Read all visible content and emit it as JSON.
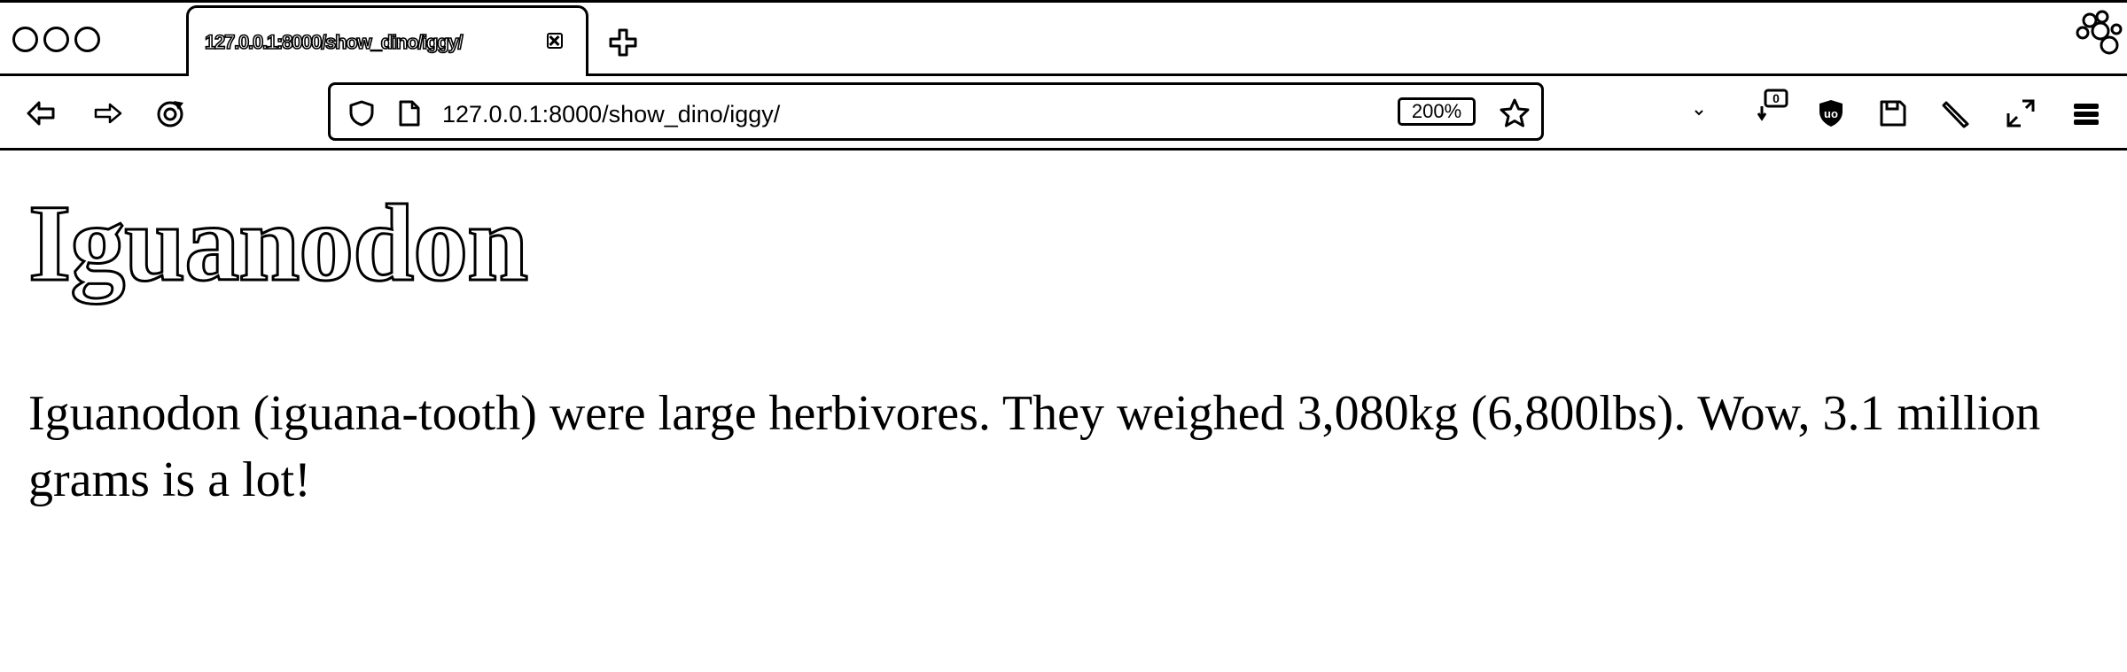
{
  "browser": {
    "tab": {
      "title": "127.0.0.1:8000/show_dino/iggy/",
      "close_icon": "close-icon"
    },
    "new_tab_icon": "plus-icon",
    "extension_logo_icon": "hexagon-cluster-icon",
    "nav": {
      "back_icon": "back-arrow-icon",
      "forward_icon": "forward-arrow-icon",
      "reload_icon": "reload-icon"
    },
    "urlbar": {
      "shield_icon": "shield-icon",
      "page_icon": "page-icon",
      "url": "127.0.0.1:8000/show_dino/iggy/",
      "zoom": "200%",
      "bookmark_icon": "star-icon"
    },
    "toolbar_icons": [
      "small-chevron-icon",
      "download-badge-icon",
      "ublock-shield-icon",
      "save-icon",
      "pen-icon",
      "expand-icon",
      "menu-icon"
    ],
    "download_badge_count": "0"
  },
  "page": {
    "heading": "Iguanodon",
    "paragraph": "Iguanodon (iguana-tooth) were large herbivores. They weighed 3,080kg (6,800lbs). Wow, 3.1 million grams is a lot!"
  }
}
